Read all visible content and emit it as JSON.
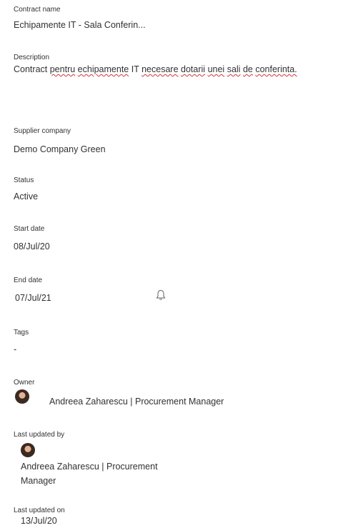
{
  "contract_name": {
    "label": "Contract name",
    "value": "Echipamente IT - Sala Conferin..."
  },
  "description": {
    "label": "Description",
    "words": [
      "Contract",
      "pentru",
      "echipamente",
      "IT",
      "necesare",
      "dotarii",
      "unei",
      "sali",
      "de",
      "conferinta."
    ],
    "misspelled": [
      false,
      true,
      true,
      false,
      true,
      true,
      true,
      true,
      true,
      true
    ]
  },
  "supplier": {
    "label": "Supplier company",
    "value": "Demo Company Green"
  },
  "status": {
    "label": "Status",
    "value": "Active"
  },
  "start_date": {
    "label": "Start date",
    "value": "08/Jul/20"
  },
  "end_date": {
    "label": "End date",
    "value": "07/Jul/21",
    "icon": "bell-icon"
  },
  "tags": {
    "label": "Tags",
    "value": "-"
  },
  "owner": {
    "label": "Owner",
    "name": "Andreea Zaharescu | Procurement Manager"
  },
  "last_updated_by": {
    "label": "Last updated by",
    "name_line1": "Andreea Zaharescu | Procurement",
    "name_line2": "Manager"
  },
  "last_updated_on": {
    "label": "Last updated on",
    "value": "13/Jul/20"
  }
}
